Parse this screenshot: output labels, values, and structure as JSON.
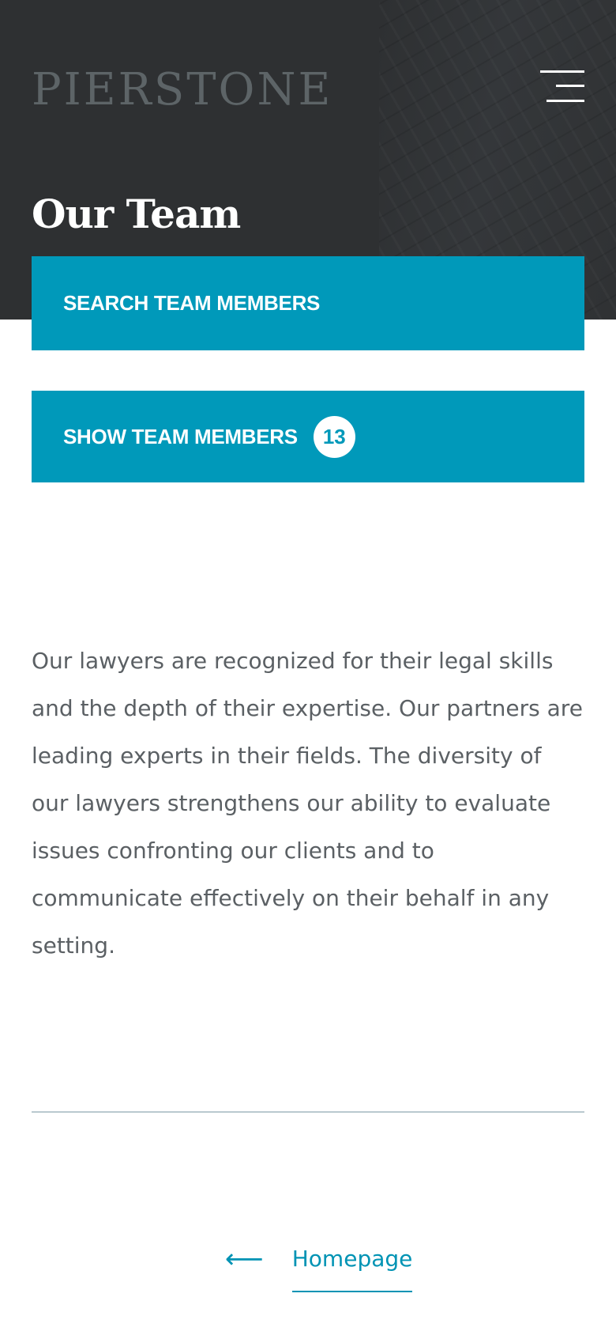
{
  "header": {
    "logo_text": "PIERSTONE",
    "menu_icon": "hamburger-menu-icon"
  },
  "page": {
    "title": "Our Team"
  },
  "actions": {
    "search_label": "SEARCH TEAM MEMBERS",
    "show_label": "SHOW TEAM MEMBERS",
    "member_count": "13"
  },
  "intro": {
    "text": "Our lawyers are recognized for their legal skills and the depth of their expertise. Our partners are leading experts in their fields. The diversity of our lawyers strengthens our ability to evaluate issues confronting our clients and to communicate effectively on their behalf in any setting."
  },
  "footer": {
    "back_arrow": "⟵",
    "back_arrow_icon": "arrow-left-icon",
    "homepage_label": "Homepage"
  },
  "colors": {
    "hero_background": "#2e3032",
    "accent": "#0099ba",
    "body_text": "#5b6064",
    "link": "#0093b4",
    "divider": "#b9c9cf"
  }
}
